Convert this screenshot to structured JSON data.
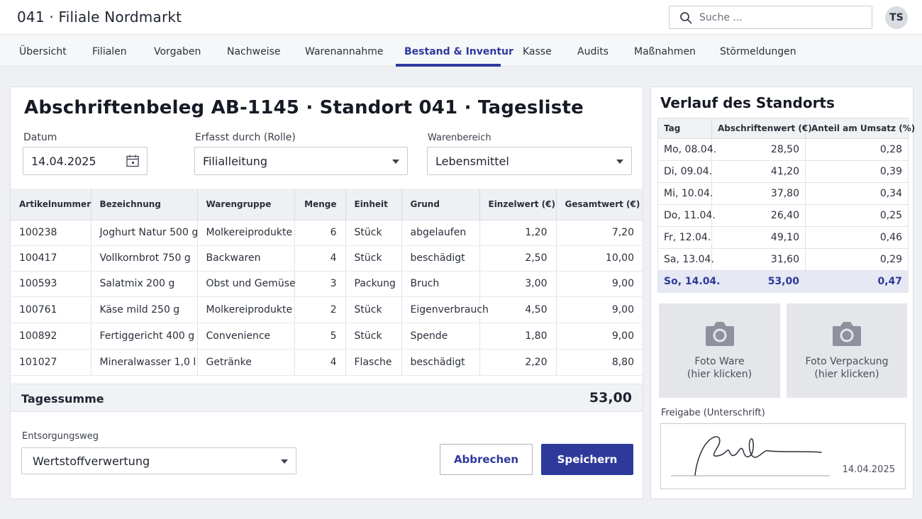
{
  "header": {
    "title": "041 · Filiale Nordmarkt",
    "search_placeholder": "Suche ...",
    "avatar_initials": "TS"
  },
  "nav": {
    "items": [
      "Übersicht",
      "Filialen",
      "Vorgaben",
      "Nachweise",
      "Warenannahme",
      "Bestand & Inventur",
      "Kasse",
      "Audits",
      "Maßnahmen",
      "Störmeldungen"
    ],
    "active": "Bestand & Inventur"
  },
  "document": {
    "title": "Abschriftenbeleg AB-1145 · Standort 041 · Tagesliste",
    "date_label": "Datum",
    "date_value": "14.04.2025",
    "recorder_label": "Erfasst durch (Rolle)",
    "recorder_value": "Filialleitung",
    "area_label": "Warenbereich",
    "area_value": "Lebensmittel"
  },
  "table": {
    "columns": [
      "Artikelnummer",
      "Bezeichnung",
      "Warengruppe",
      "Menge",
      "Einheit",
      "Grund",
      "Einzelwert (€)",
      "Gesamtwert (€)"
    ],
    "rows": [
      [
        "100238",
        "Joghurt Natur 500 g",
        "Molkereiprodukte",
        "6",
        "Stück",
        "abgelaufen",
        "1,20",
        "7,20"
      ],
      [
        "100417",
        "Vollkornbrot 750 g",
        "Backwaren",
        "4",
        "Stück",
        "beschädigt",
        "2,50",
        "10,00"
      ],
      [
        "100593",
        "Salatmix 200 g",
        "Obst und Gemüse",
        "3",
        "Packung",
        "Bruch",
        "3,00",
        "9,00"
      ],
      [
        "100761",
        "Käse mild 250 g",
        "Molkereiprodukte",
        "2",
        "Stück",
        "Eigenverbrauch",
        "4,50",
        "9,00"
      ],
      [
        "100892",
        "Fertiggericht 400 g",
        "Convenience",
        "5",
        "Stück",
        "Spende",
        "1,80",
        "9,00"
      ],
      [
        "101027",
        "Mineralwasser 1,0 l",
        "Getränke",
        "4",
        "Flasche",
        "beschädigt",
        "2,20",
        "8,80"
      ]
    ],
    "sum_label": "Tagessumme",
    "sum_value": "53,00"
  },
  "disposal": {
    "label": "Entsorgungsweg",
    "value": "Wertstoffverwertung"
  },
  "buttons": {
    "cancel": "Abbrechen",
    "save": "Speichern"
  },
  "history": {
    "title": "Verlauf des Standorts",
    "columns": [
      "Tag",
      "Abschriftenwert (€)",
      "Anteil am Umsatz (%)"
    ],
    "rows": [
      [
        "Mo, 08.04.",
        "28,50",
        "0,28"
      ],
      [
        "Di, 09.04.",
        "41,20",
        "0,39"
      ],
      [
        "Mi, 10.04.",
        "37,80",
        "0,34"
      ],
      [
        "Do, 11.04.",
        "26,40",
        "0,25"
      ],
      [
        "Fr, 12.04.",
        "49,10",
        "0,46"
      ],
      [
        "Sa, 13.04.",
        "31,60",
        "0,29"
      ],
      [
        "So, 14.04.",
        "53,00",
        "0,47"
      ]
    ],
    "highlight_row": 6
  },
  "photos": {
    "ware_title": "Foto Ware",
    "ware_hint": "(hier klicken)",
    "pack_title": "Foto Verpackung",
    "pack_hint": "(hier klicken)"
  },
  "signature": {
    "label": "Freigabe (Unterschrift)",
    "date": "14.04.2025"
  },
  "colors": {
    "accent": "#2e3a9a",
    "background": "#eef0f4"
  }
}
